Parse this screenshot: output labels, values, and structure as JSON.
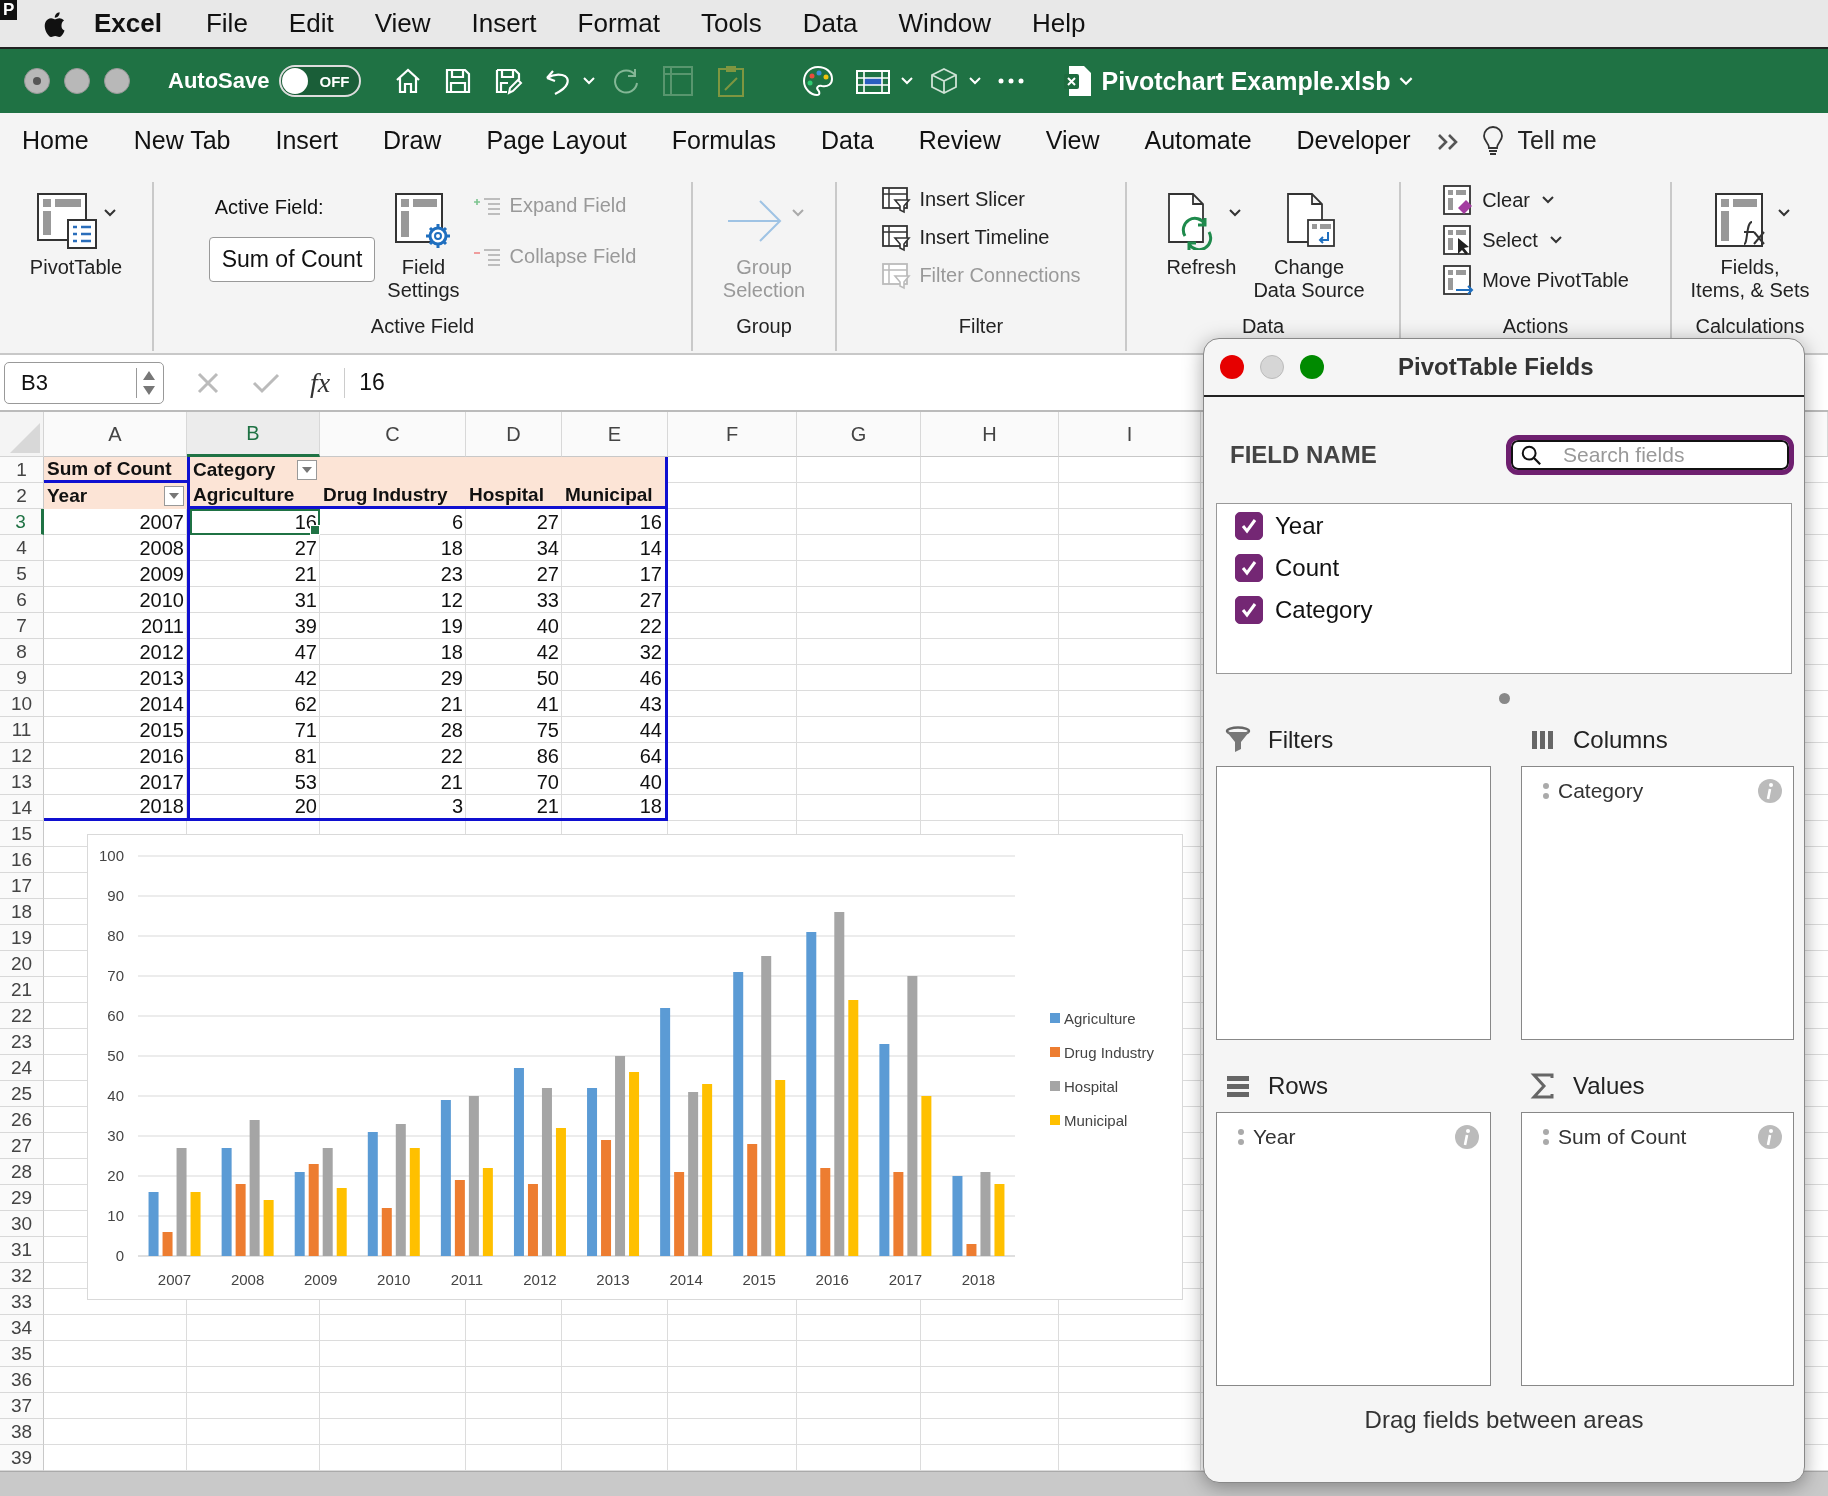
{
  "menu_bar": {
    "badge": "P",
    "app": "Excel",
    "items": [
      "File",
      "Edit",
      "View",
      "Insert",
      "Format",
      "Tools",
      "Data",
      "Window",
      "Help"
    ]
  },
  "title_bar": {
    "autosave": {
      "label": "AutoSave",
      "on": false,
      "state_text": "OFF"
    },
    "document_title": "Pivotchart Example.xlsb"
  },
  "ribbon_tabs": [
    {
      "label": "Home",
      "selected": false
    },
    {
      "label": "New Tab",
      "selected": false
    },
    {
      "label": "Insert",
      "selected": false
    },
    {
      "label": "Draw",
      "selected": false
    },
    {
      "label": "Page Layout",
      "selected": false
    },
    {
      "label": "Formulas",
      "selected": false
    },
    {
      "label": "Data",
      "selected": false
    },
    {
      "label": "Review",
      "selected": false
    },
    {
      "label": "View",
      "selected": false
    },
    {
      "label": "Automate",
      "selected": false
    },
    {
      "label": "Developer",
      "selected": false
    }
  ],
  "tell_me": "Tell me",
  "ribbon": {
    "groups": [
      {
        "buttons": [
          {
            "label": "PivotTable",
            "disabled": false
          }
        ]
      },
      {
        "label": "Active Field",
        "field_label": "Active Field:",
        "field_value": "Sum of Count",
        "buttons": [
          {
            "label": "Field\nSettings",
            "disabled": false
          },
          {
            "label": "Expand Field",
            "disabled": true
          },
          {
            "label": "Collapse Field",
            "disabled": true
          }
        ]
      },
      {
        "label": "Group",
        "buttons": [
          {
            "label": "Group\nSelection",
            "disabled": true
          }
        ]
      },
      {
        "label": "Filter",
        "buttons": [
          {
            "label": "Insert Slicer",
            "disabled": false
          },
          {
            "label": "Insert Timeline",
            "disabled": false
          },
          {
            "label": "Filter Connections",
            "disabled": true
          }
        ]
      },
      {
        "label": "Data",
        "buttons": [
          {
            "label": "Refresh",
            "disabled": false
          },
          {
            "label": "Change\nData Source",
            "disabled": false
          }
        ]
      },
      {
        "label": "Actions",
        "buttons": [
          {
            "label": "Clear",
            "disabled": false
          },
          {
            "label": "Select",
            "disabled": false
          },
          {
            "label": "Move PivotTable",
            "disabled": false
          }
        ]
      },
      {
        "label": "Calculations",
        "buttons": [
          {
            "label": "Fields,\nItems, & Sets",
            "disabled": false
          }
        ]
      }
    ]
  },
  "formula_bar": {
    "name_box": "B3",
    "function_label": "fx",
    "formula": "16"
  },
  "sheet": {
    "columns": [
      {
        "label": "A",
        "selected": false
      },
      {
        "label": "B",
        "selected": true
      },
      {
        "label": "C",
        "selected": false
      },
      {
        "label": "D",
        "selected": false
      },
      {
        "label": "E",
        "selected": false
      },
      {
        "label": "F",
        "selected": false
      },
      {
        "label": "G",
        "selected": false
      },
      {
        "label": "H",
        "selected": false
      },
      {
        "label": "I",
        "selected": false
      }
    ],
    "row_numbers": [
      {
        "label": "1",
        "selected": false
      },
      {
        "label": "2",
        "selected": false
      },
      {
        "label": "3",
        "selected": true
      },
      {
        "label": "4",
        "selected": false
      },
      {
        "label": "5",
        "selected": false
      },
      {
        "label": "6",
        "selected": false
      },
      {
        "label": "7",
        "selected": false
      },
      {
        "label": "8",
        "selected": false
      },
      {
        "label": "9",
        "selected": false
      },
      {
        "label": "10",
        "selected": false
      },
      {
        "label": "11",
        "selected": false
      },
      {
        "label": "12",
        "selected": false
      },
      {
        "label": "13",
        "selected": false
      },
      {
        "label": "14",
        "selected": false
      },
      {
        "label": "15",
        "selected": false
      },
      {
        "label": "16",
        "selected": false
      },
      {
        "label": "17",
        "selected": false
      },
      {
        "label": "18",
        "selected": false
      },
      {
        "label": "19",
        "selected": false
      },
      {
        "label": "20",
        "selected": false
      },
      {
        "label": "21",
        "selected": false
      },
      {
        "label": "22",
        "selected": false
      },
      {
        "label": "23",
        "selected": false
      },
      {
        "label": "24",
        "selected": false
      },
      {
        "label": "25",
        "selected": false
      },
      {
        "label": "26",
        "selected": false
      },
      {
        "label": "27",
        "selected": false
      },
      {
        "label": "28",
        "selected": false
      },
      {
        "label": "29",
        "selected": false
      },
      {
        "label": "30",
        "selected": false
      },
      {
        "label": "31",
        "selected": false
      },
      {
        "label": "32",
        "selected": false
      },
      {
        "label": "33",
        "selected": false
      },
      {
        "label": "34",
        "selected": false
      },
      {
        "label": "35",
        "selected": false
      },
      {
        "label": "36",
        "selected": false
      },
      {
        "label": "37",
        "selected": false
      },
      {
        "label": "38",
        "selected": false
      },
      {
        "label": "39",
        "selected": false
      }
    ]
  },
  "pivot": {
    "data_field": "Sum of Count",
    "column_field": "Category",
    "row_field": "Year",
    "categories": [
      "Agriculture",
      "Drug Industry",
      "Hospital",
      "Municipal"
    ],
    "rows": [
      {
        "label": "2007",
        "values": [
          "16",
          "6",
          "27",
          "16"
        ]
      },
      {
        "label": "2008",
        "values": [
          "27",
          "18",
          "34",
          "14"
        ]
      },
      {
        "label": "2009",
        "values": [
          "21",
          "23",
          "27",
          "17"
        ]
      },
      {
        "label": "2010",
        "values": [
          "31",
          "12",
          "33",
          "27"
        ]
      },
      {
        "label": "2011",
        "values": [
          "39",
          "19",
          "40",
          "22"
        ]
      },
      {
        "label": "2012",
        "values": [
          "47",
          "18",
          "42",
          "32"
        ]
      },
      {
        "label": "2013",
        "values": [
          "42",
          "29",
          "50",
          "46"
        ]
      },
      {
        "label": "2014",
        "values": [
          "62",
          "21",
          "41",
          "43"
        ]
      },
      {
        "label": "2015",
        "values": [
          "71",
          "28",
          "75",
          "44"
        ]
      },
      {
        "label": "2016",
        "values": [
          "81",
          "22",
          "86",
          "64"
        ]
      },
      {
        "label": "2017",
        "values": [
          "53",
          "21",
          "70",
          "40"
        ]
      },
      {
        "label": "2018",
        "values": [
          "20",
          "3",
          "21",
          "18"
        ]
      }
    ]
  },
  "chart": {
    "chart_data": {
      "type": "bar",
      "categories": [
        "2007",
        "2008",
        "2009",
        "2010",
        "2011",
        "2012",
        "2013",
        "2014",
        "2015",
        "2016",
        "2017",
        "2018"
      ],
      "series": [
        {
          "name": "Agriculture",
          "color": "#5b9bd5",
          "values": [
            16,
            27,
            21,
            31,
            39,
            47,
            42,
            62,
            71,
            81,
            53,
            20
          ]
        },
        {
          "name": "Drug Industry",
          "color": "#ed7d31",
          "values": [
            6,
            18,
            23,
            12,
            19,
            18,
            29,
            21,
            28,
            22,
            21,
            3
          ]
        },
        {
          "name": "Hospital",
          "color": "#a5a5a5",
          "values": [
            27,
            34,
            27,
            33,
            40,
            42,
            50,
            41,
            75,
            86,
            70,
            21
          ]
        },
        {
          "name": "Municipal",
          "color": "#ffc000",
          "values": [
            16,
            14,
            17,
            27,
            22,
            32,
            46,
            43,
            44,
            64,
            40,
            18
          ]
        }
      ],
      "ylim": [
        0,
        100
      ],
      "yticks": [
        0,
        10,
        20,
        30,
        40,
        50,
        60,
        70,
        80,
        90,
        100
      ],
      "grid": true,
      "legend": true
    }
  },
  "pivot_fields_panel": {
    "title": "PivotTable Fields",
    "field_name_header": "FIELD NAME",
    "search": {
      "placeholder": "Search fields"
    },
    "fields": [
      {
        "label": "Year",
        "checked": true
      },
      {
        "label": "Count",
        "checked": true
      },
      {
        "label": "Category",
        "checked": true
      }
    ],
    "areas": [
      {
        "kind": "filters",
        "label": "Filters"
      },
      {
        "kind": "columns",
        "label": "Columns",
        "items": [
          "Category"
        ]
      },
      {
        "kind": "rows",
        "label": "Rows",
        "items": [
          "Year"
        ]
      },
      {
        "kind": "values",
        "label": "Values",
        "items": [
          "Sum of Count"
        ]
      }
    ],
    "footer": "Drag fields between areas"
  }
}
